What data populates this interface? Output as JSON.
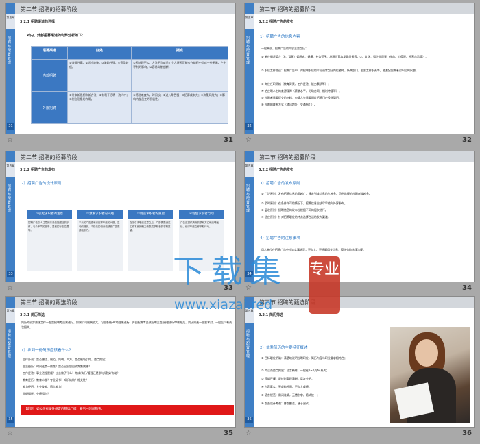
{
  "footers": {
    "star": "☆",
    "nums": [
      "31",
      "32",
      "33",
      "34",
      "35",
      "36"
    ]
  },
  "slides": {
    "s1": {
      "header": "第二节 招聘的招募阶段",
      "side_tab": "第五章",
      "side_text": "招聘与配置管理",
      "side_num": "31",
      "subhead": "3.2.1 招聘渠道的选择",
      "intro": "对内、外部招募渠道的利弊分析如下：",
      "table": {
        "headers": [
          "招募渠道",
          "好处",
          "疑点"
        ],
        "rows": [
          {
            "name": "内部招聘",
            "pros": "①准确性高；②适应较快；③激励性强；④费用较低。",
            "cons": "①因处理不公、方法不当或员工个人原因可能会在组织中造成一些矛盾，产生不利的影响；②容易抑制创新。"
          },
          {
            "name": "外部招聘",
            "pros": "①带来新思想和新方法；②有利于招聘一流人才；③树立形象的作用。",
            "cons": "①筛选难度大，时间长；②进入角色慢；③招募成本大；④决策风险大；⑤影响内部员工的积极性。"
          }
        ]
      }
    },
    "s2": {
      "header": "第二节 招聘的招募阶段",
      "side_tab": "第五章",
      "side_text": "招聘与配置管理",
      "side_num": "32",
      "subhead": "3.2.2 招聘广告的发布",
      "section": "1）招聘广告的信息内容",
      "lines": [
        "一般来说，招聘广告的内容主要包括：",
        "① 单位情况简介（6、背景）如历史、规模、业务范围、地理位置和发展前景等；③、文化：如企业愿景、使命、价值观、经营宗旨等）；",
        "② 职位工作描述：招聘广告中，对招聘职位的介绍通常包括岗位名称、所属部门、主要工作职责等。能激起应聘者对职位的兴趣。",
        "③ 岗位任职资格（教育背景、工作经验、能力素质等）；",
        "④ 给应聘人士的来源保障（薪酬水平、劳动合同、福利待遇等）；",
        "⑤ 应聘者需要提交的材料：申请人先需要通过招聘门户投递简历；",
        "⑥ 应聘的联系方式（通讯地址、交通指引）。"
      ]
    },
    "s3": {
      "header": "第二节 招聘的招募阶段",
      "side_tab": "第五章",
      "side_text": "招聘与配置管理",
      "side_num": "33",
      "subhead": "3.2.2 招聘广告的发布",
      "section": "2）招聘广告的设计原则",
      "boxes": [
        {
          "title": "①引起求职者的注意",
          "text": "招聘广告引人注意的方法包括醒目的字体、与众不同的色彩、显著的标志位置等。"
        },
        {
          "title": "②激发求职者的兴趣",
          "text": "平淡的广告很难引起求职者的兴趣，生动的措辞、个性化的设计能够使广告更具吸引力。"
        },
        {
          "title": "③创造求职者的愿望",
          "text": "在吸引求职者注意之后，广告需要通过工作本身的魅力来激发求职者的求职愿望。"
        },
        {
          "title": "④促使求职者行动",
          "text": "广告应提供清晰的联系方式和应聘途径，使求职者立即采取行动。"
        }
      ]
    },
    "s4": {
      "header": "第二节 招聘的招募阶段",
      "side_tab": "第五章",
      "side_text": "招聘与配置管理",
      "side_num": "34",
      "subhead": "3.2.2 招聘广告的发布",
      "section": "3）招聘广告的发布原则",
      "lines": [
        "① 广泛原则：发布招聘信息的面越广，接收到该信息的人越多，可供选择的应聘者就越多。",
        "② 及时原则：在条件许可的情况下，招聘信息应该尽早地向外界发布。",
        "③ 层次原则：招聘信息的发布应根据不同的层次进行。",
        "④ 适应原则：针对招聘职位的特点选择合适的发布渠道。"
      ],
      "section2": "4）招聘广告的注意事项",
      "note": "用人单位在招聘广告中应该实事求是，不夸大、不隐瞒相关信息，遵守劳动法律法规。"
    },
    "s5": {
      "header": "第三节 招聘的甄选阶段",
      "side_tab": "第五章",
      "side_text": "招聘与配置管理",
      "side_num": "35",
      "subhead": "3.3.1 简历筛选",
      "intro": "简历的初步筛选工作一般是招聘专员来进行，如果公司规模较大，可由各级HR助理来进行，并由招聘专员或招聘主管/经理进行审核把关，简历筛选一面要求对，一般至少有两次把关。",
      "question": "1）拿到一份简历应该看什么？",
      "checks": [
        "总体外观：是否整洁、规范、简明、大方，是否能吸引你，重点突出；",
        "生涯经历：时间连贯一致性？是否出现空白或频繁跳槽？",
        "工作经验：事业进程是顺？过去做了什么？完成/执行/管理还是参与/建议/协助？",
        "教育经历：教育水准？专业证书？知识结构？相关性？",
        "能力经历：专业技能、语言能力？",
        "业绩描述：业绩如何？"
      ],
      "note": "【说明】如公司有硬性规定的筛选门槛，要另一时间筛查。"
    },
    "s6": {
      "header": "第三节 招聘的甄选阶段",
      "side_tab": "第五章",
      "side_text": "招聘与配置管理",
      "side_num": "36",
      "subhead": "3.3.1 简历筛选",
      "section": "2）优秀简历的主要特征概述",
      "lines": [
        "① 目标职位明确：清楚地说明应聘职位，简历内容与职位要求相符合；",
        "② 简洁而重点突出：语言精练，一般在1~2页A4纸内；",
        "③ 逻辑严谨：叙述时条理清晰，层次分明；",
        "④ 内容真实：不虚构经历，不夸大成绩；",
        "⑤ 语言规范：用词准确，无错别字，格式统一；",
        "⑥ 版面设计美观：排版整洁，便于阅读。"
      ]
    }
  },
  "watermark": {
    "title": "下载集",
    "url": "www.xiazai.red",
    "seal": "专业"
  },
  "colors": {
    "accent": "#3f7fc5",
    "watermark": "#2a8ad8",
    "seal": "#c83a2a",
    "note_red": "#e01818"
  }
}
